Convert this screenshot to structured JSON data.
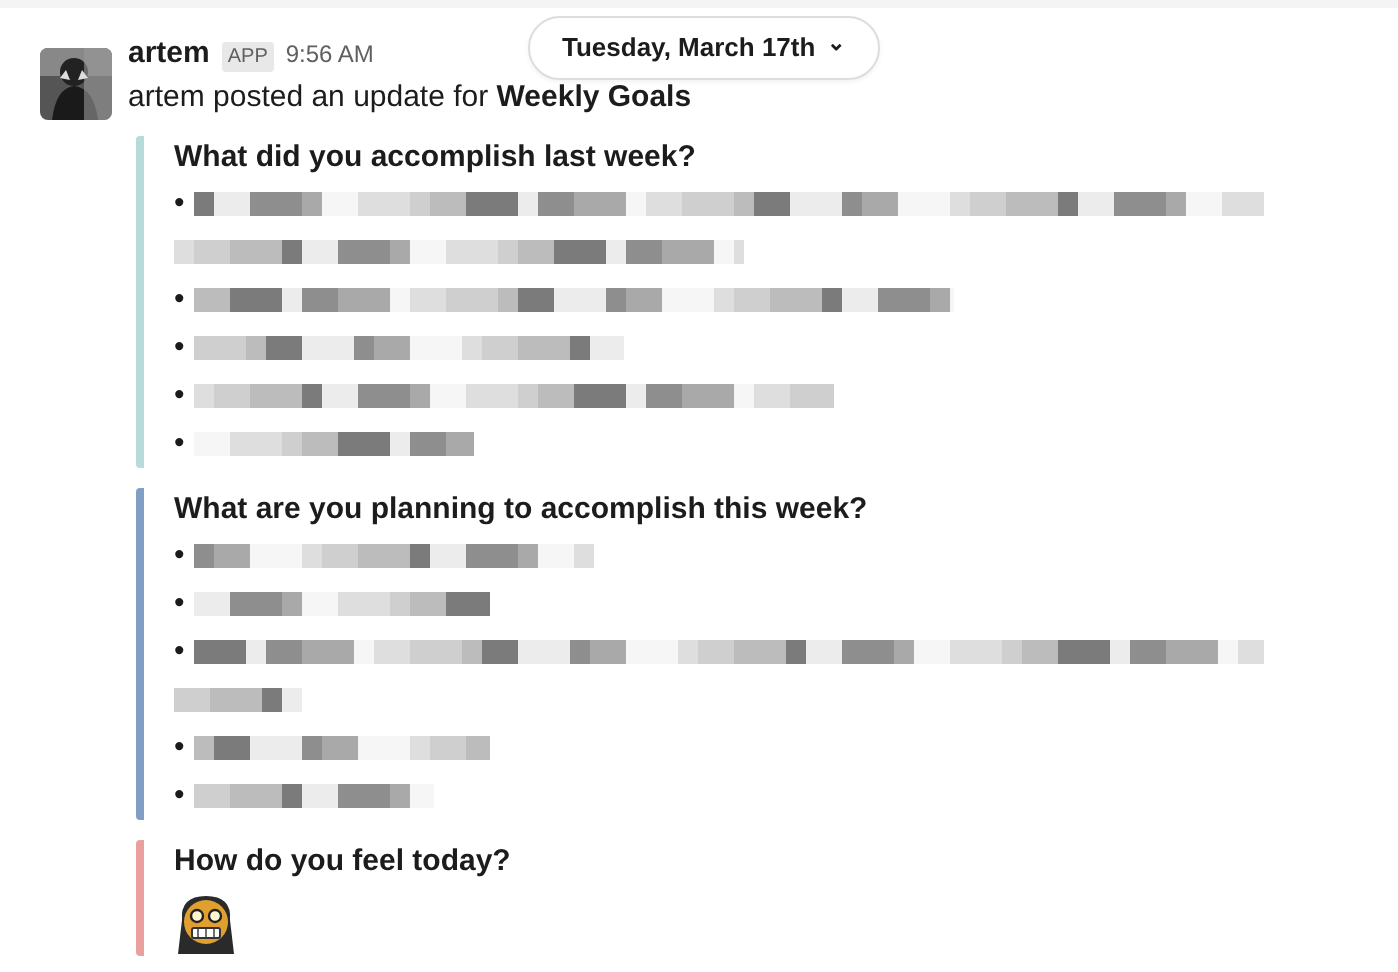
{
  "message": {
    "author": "artem",
    "app_badge": "APP",
    "time": "9:56 AM",
    "date_divider": "Tuesday, March 17th",
    "date_caret": "⌄",
    "intro": "artem posted an update for **Weekly Goals**",
    "sections": [
      {
        "question": "What did you accomplish last week?",
        "color": "#b7dada",
        "items": [
          {
            "bullet": "•"
          },
          {
            "bullet": "•"
          },
          {
            "bullet": "•"
          },
          {
            "bullet": "•"
          },
          {
            "bullet": "•"
          }
        ]
      },
      {
        "question": "What are you planning to accomplish this week?",
        "color": "#819fc5",
        "items": [
          {
            "bullet": "•"
          },
          {
            "bullet": "•"
          },
          {
            "bullet": "•"
          },
          {
            "bullet": "•"
          },
          {
            "bullet": "•"
          }
        ]
      },
      {
        "question": "How do you feel today?",
        "color": "#eba0a0",
        "answer": {
          "kind": "emoji"
        }
      }
    ]
  }
}
